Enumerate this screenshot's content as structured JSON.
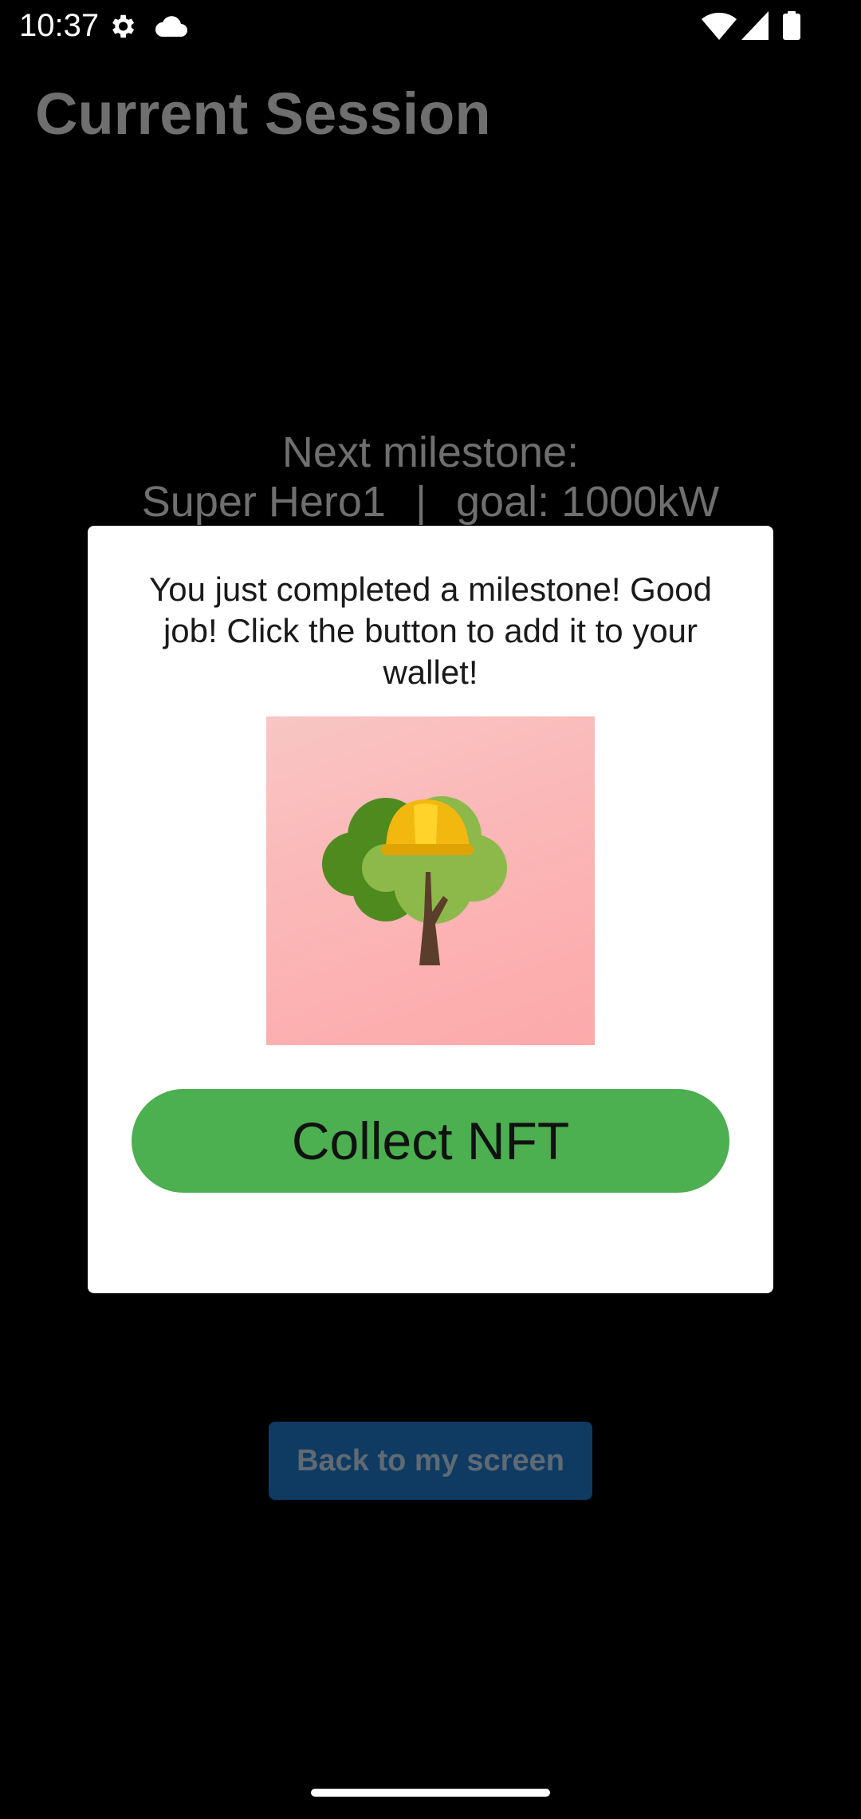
{
  "status_bar": {
    "time": "10:37",
    "left_icons": [
      "gear-icon",
      "cloud-icon"
    ],
    "right_icons": [
      "wifi-icon",
      "cellular-icon",
      "battery-icon"
    ]
  },
  "screen": {
    "title": "Current Session",
    "milestone_heading": "Next milestone:",
    "milestone_name": "Super Hero1",
    "milestone_separator": "|",
    "milestone_goal": "goal: 1000kW",
    "back_button_label": "Back to my screen"
  },
  "dialog": {
    "message": "You just completed a milestone! Good job! Click the button to add it to your wallet!",
    "image_icon": "tree-with-hardhat-icon",
    "collect_button_label": "Collect NFT"
  },
  "colors": {
    "background": "#000000",
    "dimmed_text": "#6f6f6f",
    "back_button_bg": "#0f3b63",
    "collect_button_bg": "#4caf50",
    "dialog_bg": "#ffffff",
    "nft_bg": "#fbb8b8"
  }
}
